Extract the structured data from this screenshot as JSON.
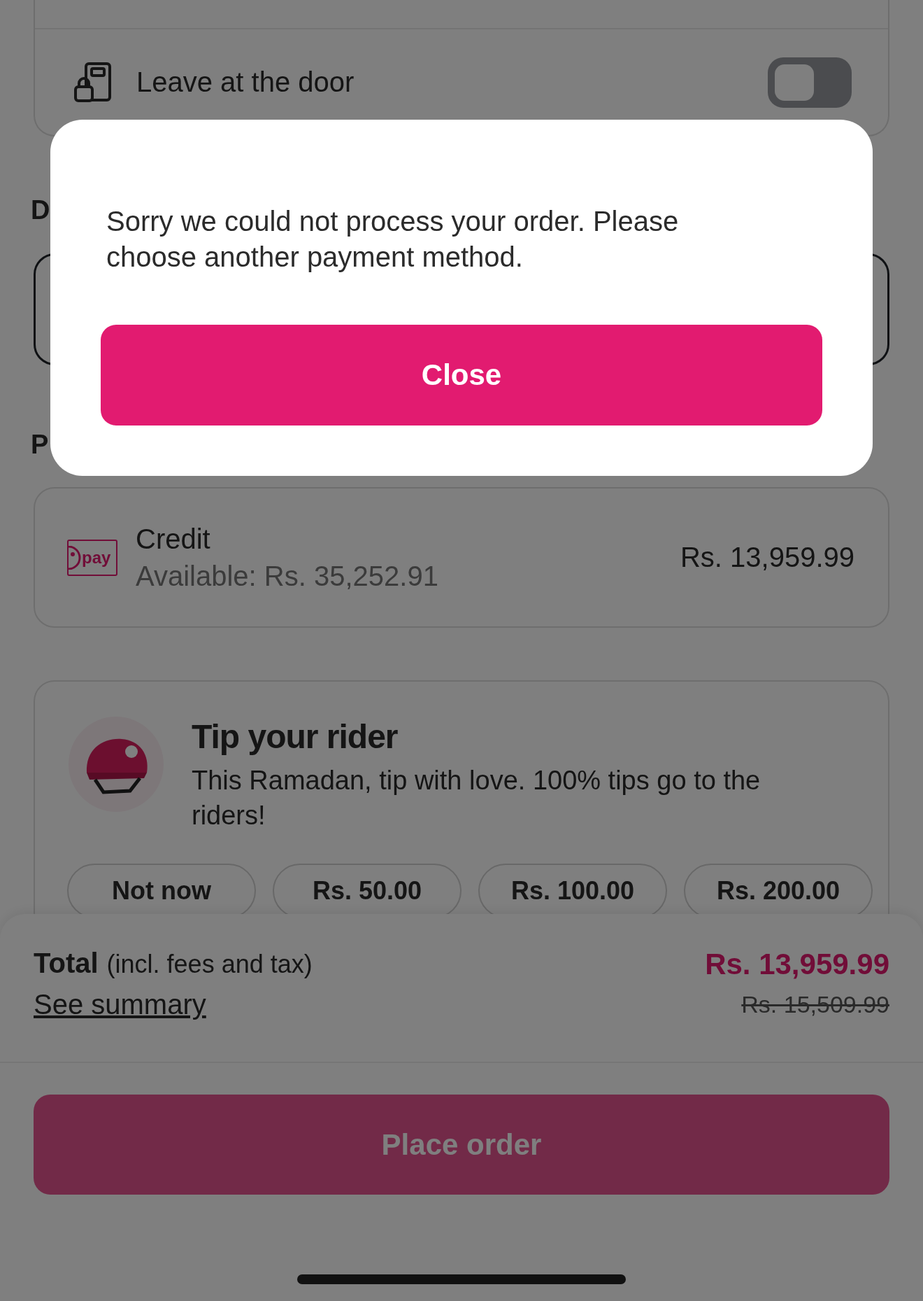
{
  "delivery": {
    "option": {
      "label": "Leave at the door",
      "on": false
    },
    "heading": "D"
  },
  "payment": {
    "heading": "P",
    "method": {
      "logo_text": "pay",
      "name": "Credit",
      "available": "Available: Rs. 35,252.91",
      "amount": "Rs. 13,959.99"
    }
  },
  "tip": {
    "title": "Tip your rider",
    "description": "This Ramadan, tip with love. 100% tips go to the riders!",
    "options": [
      {
        "label": "Not now",
        "selected": false
      },
      {
        "label": "Rs. 50.00",
        "selected": false
      },
      {
        "label": "Rs. 100.00",
        "selected": false
      },
      {
        "label": "Rs. 200.00",
        "selected": false
      }
    ]
  },
  "footer": {
    "total_label": "Total",
    "total_note": "(incl. fees and tax)",
    "summary_link": "See summary",
    "total": "Rs. 13,959.99",
    "original_total": "Rs. 15,509.99",
    "place_order": "Place order"
  },
  "dialog": {
    "message": "Sorry we could not process your order. Please choose another payment method.",
    "button": "Close"
  }
}
